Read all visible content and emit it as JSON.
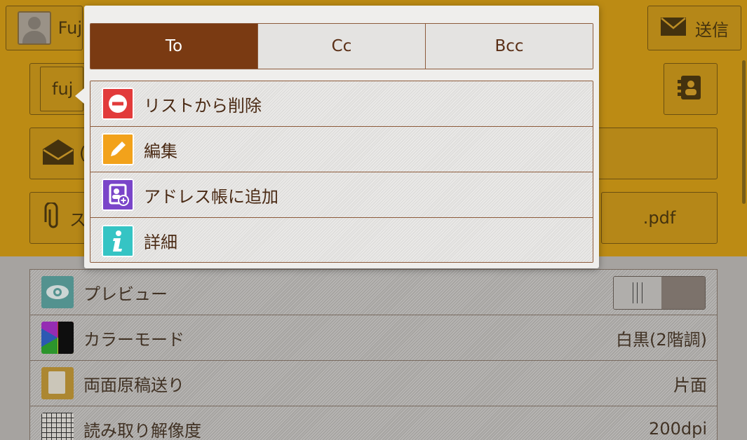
{
  "background": {
    "sender": {
      "name": "Fuj"
    },
    "send_button": {
      "label": "送信"
    },
    "to_field": {
      "value": "fuj"
    },
    "subject_row": {
      "value": "("
    },
    "attachment_row": {
      "value": "ス"
    },
    "attachment_filename": ".pdf",
    "settings": [
      {
        "label": "プレビュー",
        "value": "",
        "icon": "eye-icon",
        "control": "toggle",
        "toggle_on": true
      },
      {
        "label": "カラーモード",
        "value": "白黒(2階調)",
        "icon": "color-mode-icon"
      },
      {
        "label": "両面原稿送り",
        "value": "片面",
        "icon": "duplex-icon"
      },
      {
        "label": "読み取り解像度",
        "value": "200dpi",
        "icon": "resolution-grid-icon"
      }
    ]
  },
  "popover": {
    "tabs": [
      {
        "label": "To",
        "active": true
      },
      {
        "label": "Cc",
        "active": false
      },
      {
        "label": "Bcc",
        "active": false
      }
    ],
    "menu": [
      {
        "label": "リストから削除",
        "icon": "remove-circle-icon",
        "color": "#e23b3b"
      },
      {
        "label": "編集",
        "icon": "pencil-icon",
        "color": "#f2a21b"
      },
      {
        "label": "アドレス帳に追加",
        "icon": "address-book-add-icon",
        "color": "#7a45c9"
      },
      {
        "label": "詳細",
        "icon": "info-icon",
        "color": "#35c4c4"
      }
    ]
  },
  "colors": {
    "accent": "#7a3a12",
    "header_bg": "#d79f17"
  }
}
